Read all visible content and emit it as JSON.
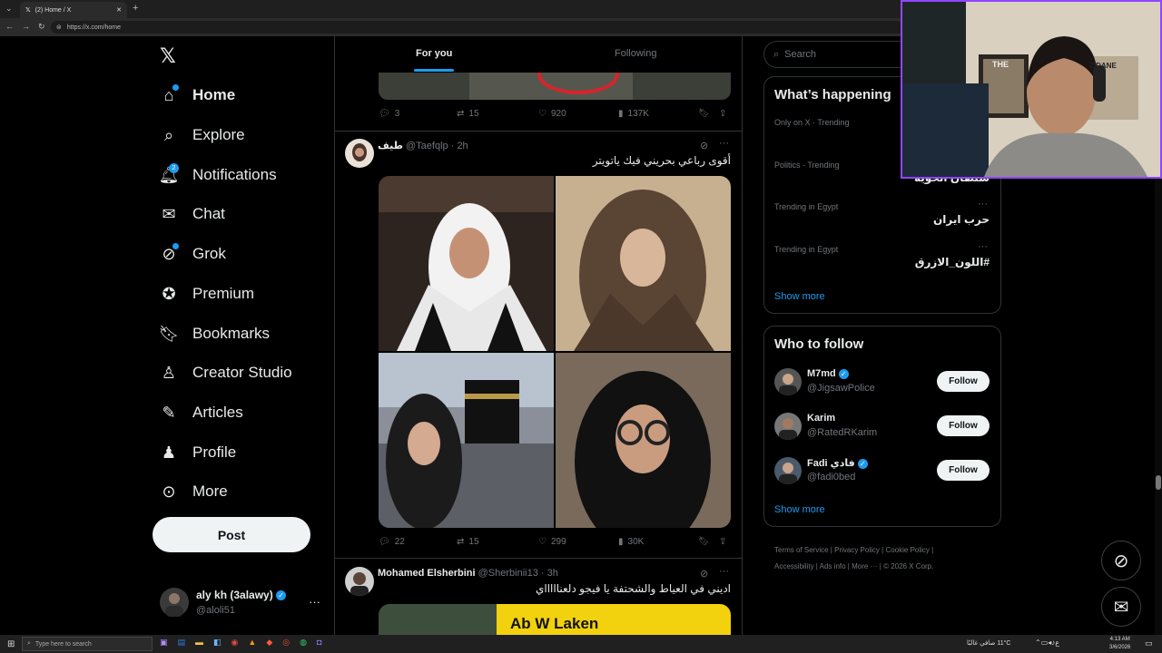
{
  "browser": {
    "tab_title": "(2) Home / X",
    "url": "https://x.com/home"
  },
  "sidebar": {
    "items": [
      {
        "label": "Home",
        "icon": "home-icon"
      },
      {
        "label": "Explore",
        "icon": "search-icon"
      },
      {
        "label": "Notifications",
        "icon": "bell-icon",
        "badge": "2"
      },
      {
        "label": "Chat",
        "icon": "mail-icon"
      },
      {
        "label": "Grok",
        "icon": "grok-icon"
      },
      {
        "label": "Premium",
        "icon": "premium-icon"
      },
      {
        "label": "Bookmarks",
        "icon": "bookmark-icon"
      },
      {
        "label": "Creator Studio",
        "icon": "creator-icon"
      },
      {
        "label": "Articles",
        "icon": "articles-icon"
      },
      {
        "label": "Profile",
        "icon": "profile-icon"
      },
      {
        "label": "More",
        "icon": "more-circle-icon"
      }
    ],
    "post_label": "Post",
    "account": {
      "name": "aly kh (3alawy)",
      "handle": "@aloli51"
    }
  },
  "feed": {
    "tabs": [
      "For you",
      "Following"
    ],
    "top_actions": {
      "replies": "3",
      "reposts": "15",
      "likes": "920",
      "views": "137K"
    },
    "post1": {
      "name": "طيف",
      "handle": "@Taefqlp",
      "time": "· 2h",
      "text": "أقوى رباعي بحريني فيك ياتويتر",
      "actions": {
        "replies": "22",
        "reposts": "15",
        "likes": "299",
        "views": "30K"
      }
    },
    "post2": {
      "name": "Mohamed Elsherbini",
      "handle": "@Sherbinii13",
      "time": "· 3h",
      "text": "اديني في العياط والشحتفة يا فيجو دلعناااااي",
      "media_text": "Ab W Laken"
    }
  },
  "right": {
    "search_placeholder": "Search",
    "happening_title": "What’s happening",
    "trends": [
      {
        "meta": "Only on X · Trending",
        "title": ""
      },
      {
        "meta": "Politics · Trending",
        "title": "سلطان الحوية"
      },
      {
        "meta": "Trending in Egypt",
        "title": "حرب ايران"
      },
      {
        "meta": "Trending in Egypt",
        "title": "#اللون_الازرق"
      }
    ],
    "show_more": "Show more",
    "wtf_title": "Who to follow",
    "follow_label": "Follow",
    "suggestions": [
      {
        "name": "M7md",
        "handle": "@JigsawPolice",
        "verified": true
      },
      {
        "name": "Karim",
        "handle": "@RatedRKarim",
        "verified": false
      },
      {
        "name": "Fadi فادي",
        "handle": "@fadi0bed",
        "verified": true
      }
    ],
    "footer": {
      "links": [
        "Terms of Service",
        "Privacy Policy",
        "Cookie Policy",
        "Accessibility",
        "Ads info",
        "More ···"
      ],
      "copyright": "© 2026 X Corp."
    }
  },
  "webcam": {
    "poster_text": "THE",
    "poster_text2": "ZIDANE"
  },
  "taskbar": {
    "search_placeholder": "Type here to search",
    "weather": "11°C  صافي غالبًا",
    "time": "4:13 AM",
    "date": "3/6/2026"
  },
  "colors": {
    "accent": "#1d9bf0",
    "bg": "#000000",
    "border": "#2f3336",
    "muted": "#71767b"
  }
}
